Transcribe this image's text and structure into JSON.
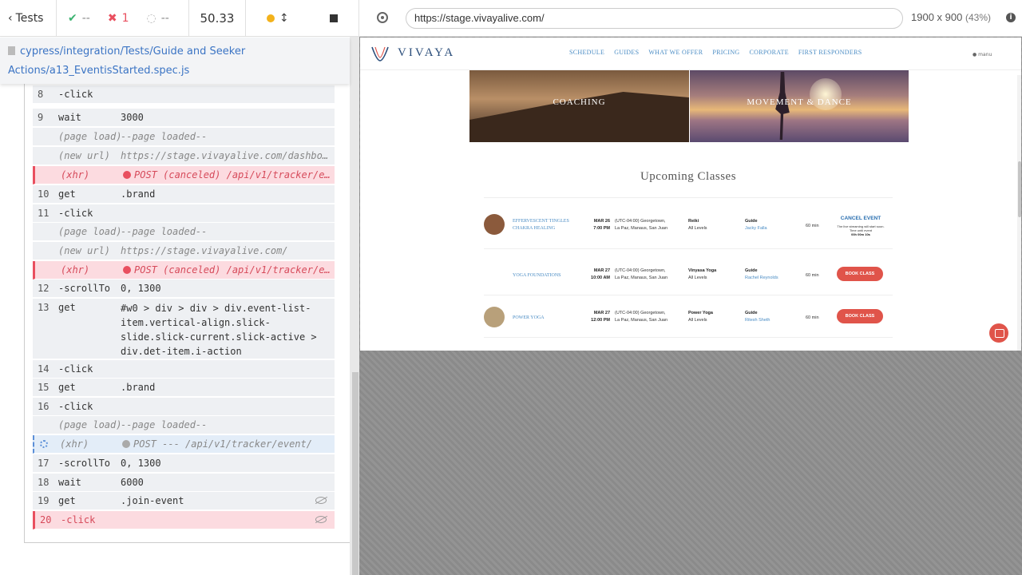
{
  "reporter": {
    "tests_label": "Tests",
    "passed": "--",
    "failed": "1",
    "pending": "--",
    "duration": "50.33",
    "spec_path_line1": "cypress/integration/Tests/Guide and Seeker",
    "spec_path_line2": "Actions/a13_EventisStarted.spec.js",
    "colors": {
      "pass": "#3cb371",
      "fail": "#e94f5f",
      "running": "#f3b21b"
    }
  },
  "commands": [
    {
      "num": "8",
      "cmd": "-click",
      "msg": ""
    },
    {
      "num": "9",
      "cmd": "wait",
      "msg": "3000"
    },
    {
      "num": "",
      "cmd": "(page load)",
      "msg": "--page loaded--"
    },
    {
      "num": "",
      "cmd": "(new url)",
      "msg": "https://stage.vivayalive.com/dashbo…"
    },
    {
      "num": "",
      "cmd": "(xhr)",
      "msg": "POST (canceled) /api/v1/tracker/e…"
    },
    {
      "num": "10",
      "cmd": "get",
      "msg": ".brand"
    },
    {
      "num": "11",
      "cmd": "-click",
      "msg": ""
    },
    {
      "num": "",
      "cmd": "(page load)",
      "msg": "--page loaded--"
    },
    {
      "num": "",
      "cmd": "(new url)",
      "msg": "https://stage.vivayalive.com/"
    },
    {
      "num": "",
      "cmd": "(xhr)",
      "msg": "POST (canceled) /api/v1/tracker/e…"
    },
    {
      "num": "12",
      "cmd": "-scrollTo",
      "msg": "0, 1300"
    },
    {
      "num": "13",
      "cmd": "get",
      "msg": "#w0 > div > div > div.event-list-item.vertical-align.slick-slide.slick-current.slick-active > div.det-item.i-action"
    },
    {
      "num": "14",
      "cmd": "-click",
      "msg": ""
    },
    {
      "num": "15",
      "cmd": "get",
      "msg": ".brand"
    },
    {
      "num": "16",
      "cmd": "-click",
      "msg": ""
    },
    {
      "num": "",
      "cmd": "(page load)",
      "msg": "--page loaded--"
    },
    {
      "num": "",
      "cmd": "(xhr)",
      "msg": "POST --- /api/v1/tracker/event/"
    },
    {
      "num": "17",
      "cmd": "-scrollTo",
      "msg": "0, 1300"
    },
    {
      "num": "18",
      "cmd": "wait",
      "msg": "6000"
    },
    {
      "num": "19",
      "cmd": "get",
      "msg": ".join-event"
    },
    {
      "num": "20",
      "cmd": "-click",
      "msg": ""
    }
  ],
  "aut": {
    "url": "https://stage.vivayalive.com/",
    "viewport": "1900 x 900",
    "zoom": "(43%)"
  },
  "site": {
    "brand": "VIVAYA",
    "nav": [
      "SCHEDULE",
      "GUIDES",
      "WHAT WE OFFER",
      "PRICING",
      "CORPORATE",
      "FIRST RESPONDERS"
    ],
    "user": "manu",
    "hero": [
      "COACHING",
      "MOVEMENT & DANCE"
    ],
    "upcoming_title": "Upcoming Classes",
    "classes": [
      {
        "name": "EFFERVESCENT TINGLES CHAKRA HEALING",
        "date": "MAR 26",
        "time": "7:00 PM",
        "tz_line1": "(UTC-04:00) Georgetown,",
        "tz_line2": "La Paz, Manaus, San Juan",
        "type": "Reiki",
        "level": "All Levels",
        "guide_label": "Guide",
        "guide": "Jacky Falla",
        "duration": "60 min",
        "action": "CANCEL EVENT",
        "note": "The live streaming will start soon. Time until event",
        "countdown": "00h 00m 10s"
      },
      {
        "name": "YOGA FOUNDATIONS",
        "date": "MAR 27",
        "time": "10:00 AM",
        "tz_line1": "(UTC-04:00) Georgetown,",
        "tz_line2": "La Paz, Manaus, San Juan",
        "type": "Vinyasa Yoga",
        "level": "All Levels",
        "guide_label": "Guide",
        "guide": "Rachel Reynolds",
        "duration": "60 min",
        "action": "BOOK CLASS"
      },
      {
        "name": "POWER YOGA",
        "date": "MAR 27",
        "time": "12:00 PM",
        "tz_line1": "(UTC-04:00) Georgetown,",
        "tz_line2": "La Paz, Manaus, San Juan",
        "type": "Power Yoga",
        "level": "All Levels",
        "guide_label": "Guide",
        "guide": "Ritesh Sheth",
        "duration": "60 min",
        "action": "BOOK CLASS"
      }
    ]
  }
}
